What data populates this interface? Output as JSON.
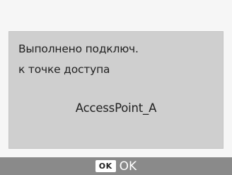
{
  "dialog": {
    "message_line1": "Выполнено подключ.",
    "message_line2": "к точке доступа",
    "access_point_name": "AccessPoint_A"
  },
  "footer": {
    "ok_key_label": "OK",
    "ok_action_label": "OK"
  }
}
